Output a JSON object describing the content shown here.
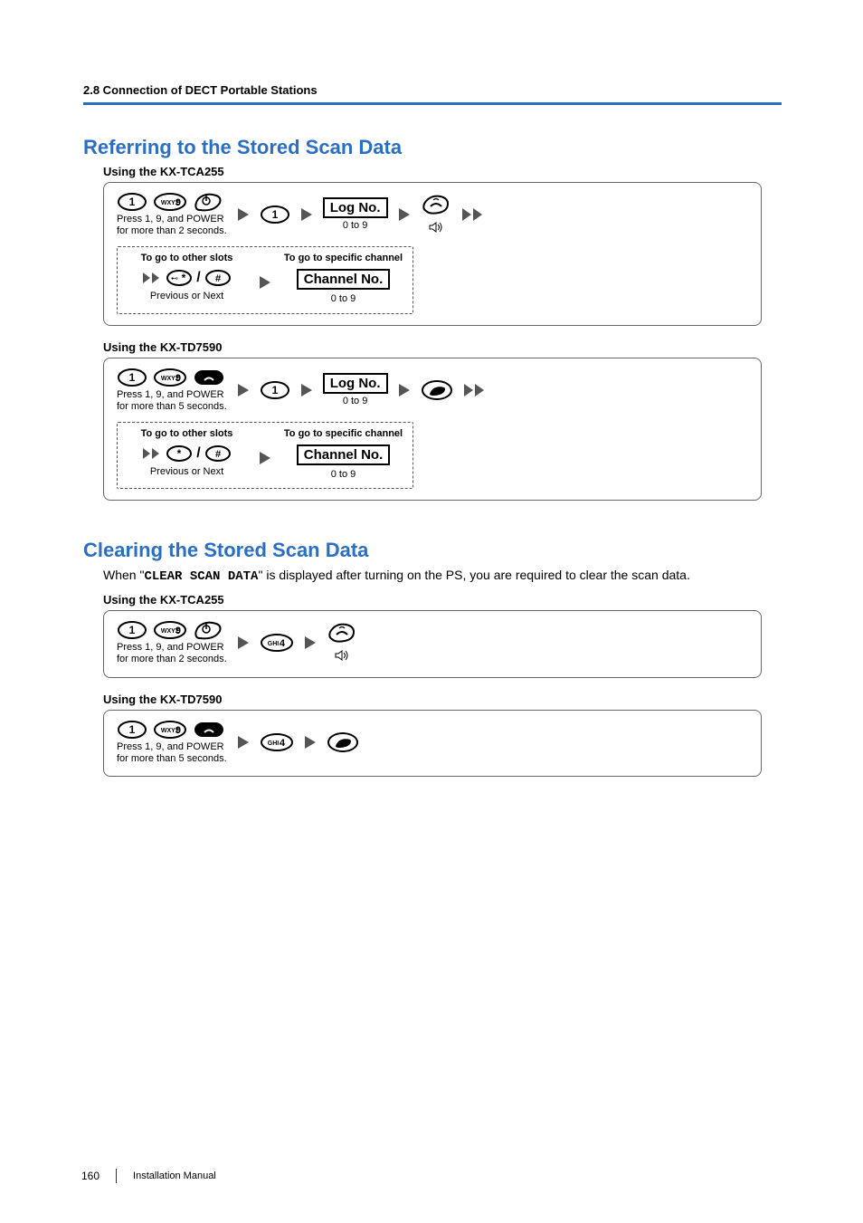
{
  "header": {
    "breadcrumb": "2.8 Connection of DECT Portable Stations"
  },
  "section1": {
    "title": "Referring to the Stored Scan Data",
    "sub1": "Using the KX-TCA255",
    "panel1": {
      "key1_label": "1",
      "key9_label": "WXYZ9",
      "caption1a": "Press 1, 9, and POWER",
      "caption1b": "for more than 2 seconds.",
      "key1b_label": "1",
      "logno": "Log No.",
      "logno_caption": "0 to 9",
      "dash_left_title": "To go to other slots",
      "dash_left_caption": "Previous or Next",
      "dash_right_title": "To go to specific channel",
      "dash_right_box": "Channel No.",
      "dash_right_caption": "0 to 9",
      "slash": "/"
    },
    "sub2": "Using the KX-TD7590",
    "panel2": {
      "key1_label": "1",
      "key9_label": "WXYZ9",
      "caption1a": "Press 1, 9, and POWER",
      "caption1b": "for more than 5 seconds.",
      "key1b_label": "1",
      "logno": "Log No.",
      "logno_caption": "0 to 9",
      "dash_left_title": "To go to other slots",
      "dash_left_caption": "Previous or Next",
      "dash_right_title": "To go to specific channel",
      "dash_right_box": "Channel No.",
      "dash_right_caption": "0 to 9",
      "slash": "/"
    }
  },
  "section2": {
    "title": "Clearing the Stored Scan Data",
    "intro_pre": "When \"",
    "intro_code": "CLEAR SCAN DATA",
    "intro_post": "\" is displayed after turning on the PS, you are required to clear the scan data.",
    "sub1": "Using the KX-TCA255",
    "panel1": {
      "key1_label": "1",
      "key9_label": "WXYZ9",
      "caption1a": "Press 1, 9, and POWER",
      "caption1b": "for more than 2 seconds.",
      "key4_label": "GHI4"
    },
    "sub2": "Using the KX-TD7590",
    "panel2": {
      "key1_label": "1",
      "key9_label": "WXYZ9",
      "caption1a": "Press 1, 9, and POWER",
      "caption1b": "for more than 5 seconds.",
      "key4_label": "GHI4"
    }
  },
  "footer": {
    "page": "160",
    "title": "Installation Manual"
  }
}
